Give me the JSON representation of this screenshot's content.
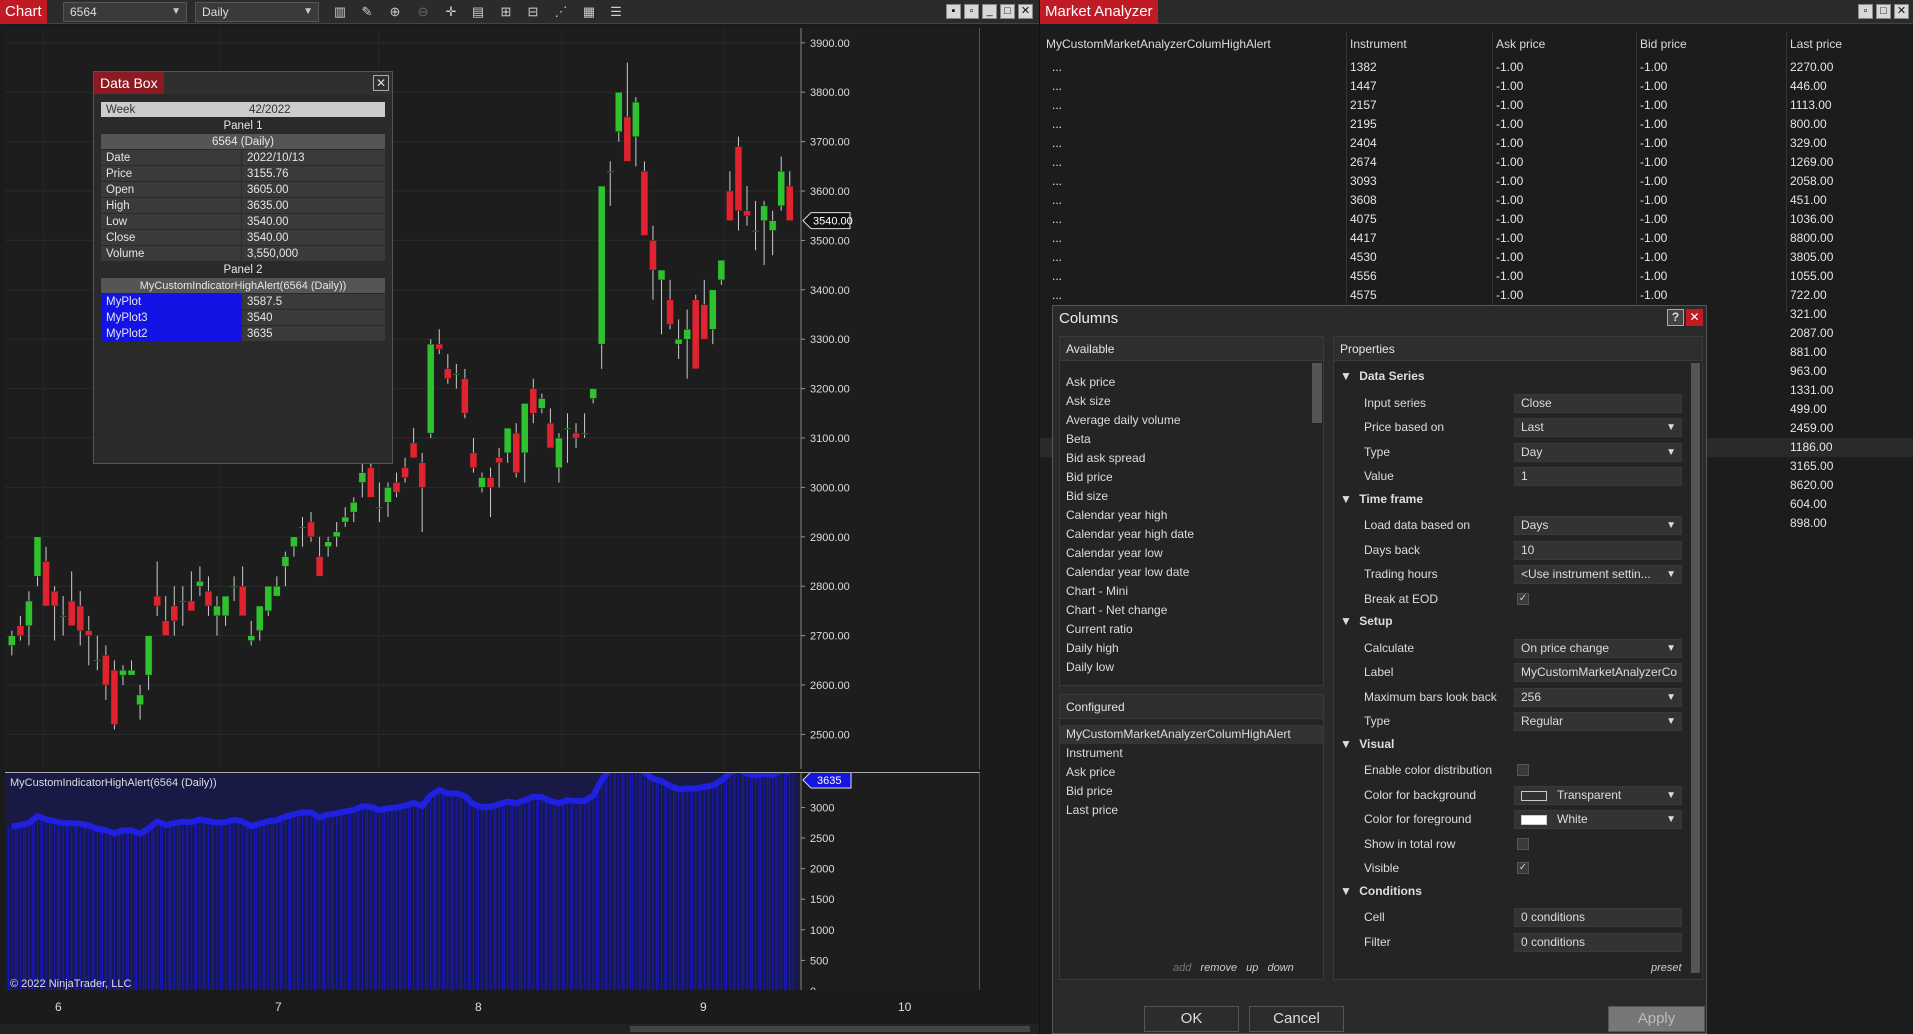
{
  "chart": {
    "title": "Chart",
    "instrument": "6564",
    "interval": "Daily",
    "toolbar_icons": [
      "bar-chart-icon",
      "pencil-icon",
      "zoom-in-icon",
      "zoom-out-icon",
      "crosshair-icon",
      "data-box-icon",
      "properties-icon",
      "indicator-icon",
      "strategy-icon",
      "ruler-icon",
      "list-icon"
    ],
    "price_label": "3540.00",
    "indicator_panel_title": "MyCustomIndicatorHighAlert(6564 (Daily))",
    "indicator_label": "3635",
    "copyright": "© 2022 NinjaTrader, LLC",
    "y_ticks": [
      "3900.00",
      "3800.00",
      "3700.00",
      "3600.00",
      "3500.00",
      "3400.00",
      "3300.00",
      "3200.00",
      "3100.00",
      "3000.00",
      "2900.00",
      "2800.00",
      "2700.00",
      "2600.00",
      "2500.00"
    ],
    "ind_ticks": [
      "3000",
      "2500",
      "2000",
      "1500",
      "1000",
      "500",
      "0"
    ],
    "x_ticks": [
      "6",
      "7",
      "8",
      "9",
      "10"
    ],
    "colors": {
      "up": "#2ec22e",
      "down": "#e0232e",
      "plot": "#1a1ad0",
      "accent": "#c01a25"
    }
  },
  "chart_data": {
    "type": "candlestick",
    "title": "",
    "xlabel": "",
    "ylabel": "",
    "ylim": [
      2430,
      3930
    ],
    "x_tick_labels": [
      "6",
      "7",
      "8",
      "9",
      "10"
    ],
    "candles": [
      [
        2680,
        2710,
        2660,
        2700
      ],
      [
        2720,
        2740,
        2690,
        2700
      ],
      [
        2720,
        2790,
        2680,
        2770
      ],
      [
        2820,
        2900,
        2800,
        2900
      ],
      [
        2850,
        2880,
        2760,
        2760
      ],
      [
        2790,
        2800,
        2690,
        2760
      ],
      [
        2740,
        2780,
        2700,
        2740
      ],
      [
        2770,
        2830,
        2740,
        2720
      ],
      [
        2760,
        2790,
        2680,
        2710
      ],
      [
        2710,
        2740,
        2640,
        2700
      ],
      [
        2650,
        2700,
        2630,
        2650
      ],
      [
        2660,
        2680,
        2570,
        2600
      ],
      [
        2630,
        2650,
        2510,
        2520
      ],
      [
        2620,
        2640,
        2600,
        2630
      ],
      [
        2620,
        2650,
        2620,
        2630
      ],
      [
        2560,
        2600,
        2530,
        2580
      ],
      [
        2620,
        2690,
        2590,
        2700
      ],
      [
        2780,
        2850,
        2740,
        2760
      ],
      [
        2730,
        2780,
        2700,
        2700
      ],
      [
        2760,
        2800,
        2700,
        2730
      ],
      [
        2770,
        2800,
        2720,
        2770
      ],
      [
        2770,
        2830,
        2750,
        2750
      ],
      [
        2800,
        2840,
        2780,
        2810
      ],
      [
        2790,
        2820,
        2740,
        2760
      ],
      [
        2740,
        2780,
        2700,
        2760
      ],
      [
        2740,
        2770,
        2720,
        2780
      ],
      [
        2800,
        2820,
        2770,
        2800
      ],
      [
        2800,
        2840,
        2740,
        2740
      ],
      [
        2690,
        2730,
        2680,
        2700
      ],
      [
        2710,
        2760,
        2690,
        2760
      ],
      [
        2750,
        2800,
        2740,
        2800
      ],
      [
        2780,
        2820,
        2780,
        2800
      ],
      [
        2840,
        2870,
        2800,
        2860
      ],
      [
        2880,
        2900,
        2860,
        2900
      ],
      [
        2920,
        2940,
        2880,
        2920
      ],
      [
        2930,
        2950,
        2890,
        2900
      ],
      [
        2860,
        2900,
        2840,
        2820
      ],
      [
        2880,
        2900,
        2860,
        2890
      ],
      [
        2900,
        2930,
        2880,
        2910
      ],
      [
        2930,
        2960,
        2920,
        2940
      ],
      [
        2950,
        2980,
        2930,
        2970
      ],
      [
        3010,
        3050,
        2980,
        3030
      ],
      [
        3040,
        3060,
        3010,
        2980
      ],
      [
        2960,
        3010,
        2930,
        2960
      ],
      [
        2970,
        3010,
        2940,
        3000
      ],
      [
        3010,
        3030,
        2980,
        2990
      ],
      [
        3040,
        3060,
        3010,
        3020
      ],
      [
        3090,
        3120,
        3060,
        3060
      ],
      [
        3050,
        3070,
        2910,
        3000
      ],
      [
        3110,
        3300,
        3100,
        3290
      ],
      [
        3290,
        3320,
        3270,
        3280
      ],
      [
        3240,
        3270,
        3210,
        3220
      ],
      [
        3230,
        3250,
        3200,
        3230
      ],
      [
        3220,
        3240,
        3140,
        3150
      ],
      [
        3070,
        3100,
        3030,
        3040
      ],
      [
        3000,
        3030,
        2990,
        3020
      ],
      [
        3020,
        3040,
        2940,
        3000
      ],
      [
        3060,
        3080,
        3000,
        3050
      ],
      [
        3070,
        3110,
        3050,
        3120
      ],
      [
        3110,
        3130,
        3020,
        3030
      ],
      [
        3070,
        3130,
        3010,
        3170
      ],
      [
        3200,
        3220,
        3130,
        3150
      ],
      [
        3160,
        3190,
        3150,
        3180
      ],
      [
        3130,
        3160,
        3080,
        3080
      ],
      [
        3040,
        3110,
        3010,
        3100
      ],
      [
        3120,
        3150,
        3050,
        3120
      ],
      [
        3110,
        3130,
        3080,
        3100
      ],
      [
        3110,
        3150,
        3100,
        3110
      ],
      [
        3180,
        3200,
        3170,
        3200
      ],
      [
        3290,
        3310,
        3240,
        3610
      ],
      [
        3640,
        3660,
        3570,
        3640
      ],
      [
        3720,
        3790,
        3700,
        3800
      ],
      [
        3750,
        3860,
        3680,
        3660
      ],
      [
        3710,
        3790,
        3650,
        3780
      ],
      [
        3640,
        3660,
        3560,
        3510
      ],
      [
        3500,
        3530,
        3380,
        3440
      ],
      [
        3420,
        3440,
        3310,
        3440
      ],
      [
        3380,
        3420,
        3320,
        3330
      ],
      [
        3290,
        3340,
        3260,
        3300
      ],
      [
        3300,
        3360,
        3220,
        3320
      ],
      [
        3380,
        3390,
        3280,
        3240
      ],
      [
        3370,
        3420,
        3300,
        3300
      ],
      [
        3320,
        3350,
        3290,
        3400
      ],
      [
        3420,
        3460,
        3410,
        3460
      ],
      [
        3600,
        3640,
        3540,
        3540
      ],
      [
        3690,
        3710,
        3520,
        3560
      ],
      [
        3560,
        3610,
        3530,
        3550
      ],
      [
        3520,
        3580,
        3480,
        3520
      ],
      [
        3540,
        3580,
        3450,
        3570
      ],
      [
        3520,
        3560,
        3470,
        3540
      ],
      [
        3570,
        3670,
        3560,
        3640
      ],
      [
        3610,
        3640,
        3560,
        3540
      ]
    ],
    "indicator": {
      "name": "MyCustomIndicatorHighAlert(6564 (Daily))",
      "ylim": [
        0,
        3400
      ],
      "last": 3635
    }
  },
  "databox": {
    "title": "Data Box",
    "week_label": "Week",
    "week_value": "42/2022",
    "panel1": "Panel 1",
    "series1": "6564 (Daily)",
    "rows": [
      [
        "Date",
        "2022/10/13"
      ],
      [
        "Price",
        "3155.76"
      ],
      [
        "Open",
        "3605.00"
      ],
      [
        "High",
        "3635.00"
      ],
      [
        "Low",
        "3540.00"
      ],
      [
        "Close",
        "3540.00"
      ],
      [
        "Volume",
        "3,550,000"
      ]
    ],
    "panel2": "Panel 2",
    "series2": "MyCustomIndicatorHighAlert(6564 (Daily))",
    "plots": [
      [
        "MyPlot",
        "3587.5"
      ],
      [
        "MyPlot3",
        "3540"
      ],
      [
        "MyPlot2",
        "3635"
      ]
    ]
  },
  "ma": {
    "title": "Market Analyzer",
    "headers": [
      "MyCustomMarketAnalyzerColumHighAlert",
      "Instrument",
      "Ask price",
      "Bid price",
      "Last price"
    ],
    "rows": [
      [
        "...",
        "1382",
        "-1.00",
        "-1.00",
        "2270.00"
      ],
      [
        "...",
        "1447",
        "-1.00",
        "-1.00",
        "446.00"
      ],
      [
        "...",
        "2157",
        "-1.00",
        "-1.00",
        "1113.00"
      ],
      [
        "...",
        "2195",
        "-1.00",
        "-1.00",
        "800.00"
      ],
      [
        "...",
        "2404",
        "-1.00",
        "-1.00",
        "329.00"
      ],
      [
        "...",
        "2674",
        "-1.00",
        "-1.00",
        "1269.00"
      ],
      [
        "...",
        "3093",
        "-1.00",
        "-1.00",
        "2058.00"
      ],
      [
        "...",
        "3608",
        "-1.00",
        "-1.00",
        "451.00"
      ],
      [
        "...",
        "4075",
        "-1.00",
        "-1.00",
        "1036.00"
      ],
      [
        "...",
        "4417",
        "-1.00",
        "-1.00",
        "8800.00"
      ],
      [
        "...",
        "4530",
        "-1.00",
        "-1.00",
        "3805.00"
      ],
      [
        "...",
        "4556",
        "-1.00",
        "-1.00",
        "1055.00"
      ],
      [
        "...",
        "4575",
        "-1.00",
        "-1.00",
        "722.00"
      ]
    ],
    "extra_last": [
      "321.00",
      "2087.00",
      "881.00",
      "963.00",
      "1331.00",
      "499.00",
      "2459.00",
      "1186.00",
      "3165.00",
      "8620.00",
      "604.00",
      "898.00"
    ]
  },
  "columns": {
    "title": "Columns",
    "available_label": "Available",
    "available": [
      "Ask price",
      "Ask size",
      "Average daily volume",
      "Beta",
      "Bid ask spread",
      "Bid price",
      "Bid size",
      "Calendar year high",
      "Calendar year high date",
      "Calendar year low",
      "Calendar year low date",
      "Chart - Mini",
      "Chart - Net change",
      "Current ratio",
      "Daily high",
      "Daily low"
    ],
    "configured_label": "Configured",
    "configured": [
      "MyCustomMarketAnalyzerColumHighAlert",
      "Instrument",
      "Ask price",
      "Bid price",
      "Last price"
    ],
    "links": {
      "add": "add",
      "remove": "remove",
      "up": "up",
      "down": "down",
      "preset": "preset"
    },
    "properties_label": "Properties",
    "sections": [
      {
        "name": "Data Series",
        "props": [
          [
            "Input series",
            "Close",
            false
          ],
          [
            "Price based on",
            "Last",
            true
          ],
          [
            "Type",
            "Day",
            true
          ],
          [
            "Value",
            "1",
            false
          ]
        ]
      },
      {
        "name": "Time frame",
        "props": [
          [
            "Load data based on",
            "Days",
            true
          ],
          [
            "Days back",
            "10",
            false
          ],
          [
            "Trading hours",
            "<Use instrument settin...",
            true
          ],
          [
            "Break at EOD",
            "✓",
            false
          ]
        ]
      },
      {
        "name": "Setup",
        "props": [
          [
            "Calculate",
            "On price change",
            true
          ],
          [
            "Label",
            "MyCustomMarketAnalyzerCo",
            false
          ],
          [
            "Maximum bars look back",
            "256",
            true
          ],
          [
            "Type",
            "Regular",
            true
          ]
        ]
      },
      {
        "name": "Visual",
        "props": [
          [
            "Enable color distribution",
            "",
            false
          ],
          [
            "Color for background",
            "Transparent",
            true
          ],
          [
            "Color for foreground",
            "White",
            true
          ],
          [
            "Show in total row",
            "",
            false
          ],
          [
            "Visible",
            "✓",
            false
          ]
        ]
      },
      {
        "name": "Conditions",
        "props": [
          [
            "Cell",
            "0 conditions",
            false
          ],
          [
            "Filter",
            "0 conditions",
            false
          ]
        ]
      }
    ],
    "ok": "OK",
    "cancel": "Cancel",
    "apply": "Apply"
  }
}
